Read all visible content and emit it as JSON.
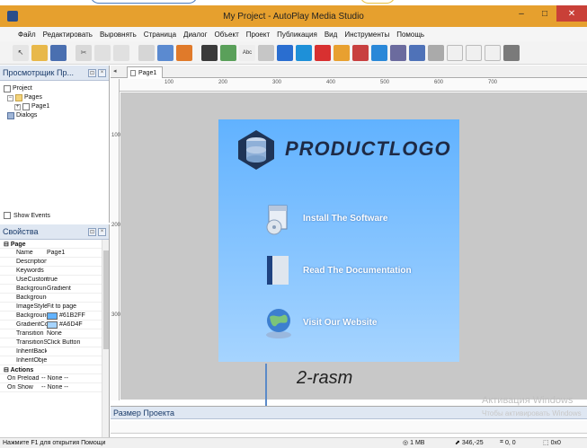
{
  "window": {
    "title": "My Project - AutoPlay Media Studio"
  },
  "menu": [
    "Файл",
    "Редактировать",
    "Выровнять",
    "Страница",
    "Диалог",
    "Объект",
    "Проект",
    "Публикация",
    "Вид",
    "Инструменты",
    "Помощь"
  ],
  "toolbar_icons": [
    "pointer-icon",
    "open-folder-icon",
    "save-icon",
    "cut-icon",
    "copy-icon",
    "paste-icon",
    "image-icon",
    "slideshow-icon",
    "flash-icon",
    "label-icon",
    "paragraph-icon",
    "button-icon",
    "web-icon",
    "quicktime-icon",
    "pdf-icon",
    "video-icon",
    "input-icon",
    "checkbox-icon",
    "radio-icon",
    "listbox-icon",
    "combobox-icon",
    "tree-icon",
    "grid-icon",
    "progress-icon",
    "slider-icon",
    "xbutton-icon"
  ],
  "explorer": {
    "title": "Просмотрщик Пр...",
    "tree": {
      "project": "Project",
      "pages": "Pages",
      "page1": "Page1",
      "dialogs": "Dialogs"
    },
    "show_events": "Show Events"
  },
  "properties": {
    "title": "Свойства",
    "categories": {
      "page": "Page",
      "actions": "Actions"
    },
    "rows": [
      {
        "key": "Name",
        "value": "Page1"
      },
      {
        "key": "Description",
        "value": ""
      },
      {
        "key": "Keywords",
        "value": ""
      },
      {
        "key": "UseCustomSc",
        "value": "true"
      },
      {
        "key": "BackgroundS",
        "value": "Gradient"
      },
      {
        "key": "BackgroundIr",
        "value": ""
      },
      {
        "key": "ImageStyle",
        "value": "Fit to page"
      },
      {
        "key": "BackgroundC",
        "value": "#61B2FF",
        "swatch": "#61b2ff"
      },
      {
        "key": "GradientColo",
        "value": "#A6D4F",
        "swatch": "#a6d4ff"
      },
      {
        "key": "Transition",
        "value": "None"
      },
      {
        "key": "TransitionSett",
        "value": "Click Button"
      },
      {
        "key": "InheritBackgr",
        "value": ""
      },
      {
        "key": "InheritObject:",
        "value": ""
      }
    ],
    "action_rows": [
      {
        "key": "On Preload",
        "value": "-- None --"
      },
      {
        "key": "On Show",
        "value": "-- None --"
      }
    ]
  },
  "tabs": [
    "Page1"
  ],
  "ruler_labels": [
    "100",
    "200",
    "300",
    "400",
    "500",
    "600",
    "700"
  ],
  "vruler_labels": [
    "100",
    "200",
    "300"
  ],
  "page": {
    "logo_text": "PRODUCTLOGO",
    "items": [
      "Install The Software",
      "Read The Documentation",
      "Visit Our Website"
    ]
  },
  "annotation": "2-rasm",
  "bottom_panel": {
    "title": "Размер Проекта"
  },
  "watermark": {
    "line1": "Активация Windows",
    "line2": "Чтобы активировать Windows"
  },
  "status": {
    "hint": "Нажмите F1 для открытия Помощи",
    "size": "1 MB",
    "coords": "346,-25",
    "pos": "0, 0",
    "dim": "0x0"
  }
}
